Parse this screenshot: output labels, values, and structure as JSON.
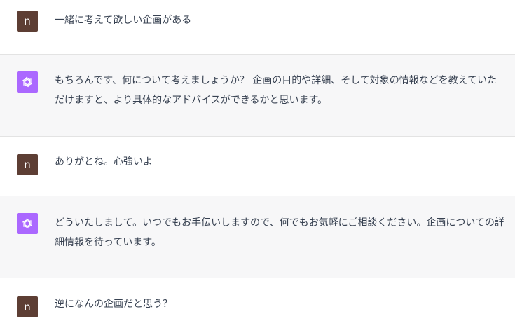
{
  "messages": [
    {
      "role": "user",
      "avatar_letter": "n",
      "text": "一緒に考えて欲しい企画がある"
    },
    {
      "role": "assistant",
      "avatar_icon": "openai-logo-icon",
      "text": "もちろんです、何について考えましょうか？ 企画の目的や詳細、そして対象の情報などを教えていただけますと、より具体的なアドバイスができるかと思います。"
    },
    {
      "role": "user",
      "avatar_letter": "n",
      "text": "ありがとね。心強いよ"
    },
    {
      "role": "assistant",
      "avatar_icon": "openai-logo-icon",
      "text": "どういたしまして。いつでもお手伝いしますので、何でもお気軽にご相談ください。企画についての詳細情報を待っています。"
    },
    {
      "role": "user",
      "avatar_letter": "n",
      "text": "逆になんの企画だと思う？"
    }
  ],
  "colors": {
    "user_avatar_bg": "#5d3e34",
    "assistant_avatar_bg": "#ab68ff",
    "assistant_row_bg": "#f7f7f8",
    "text": "#374151"
  }
}
